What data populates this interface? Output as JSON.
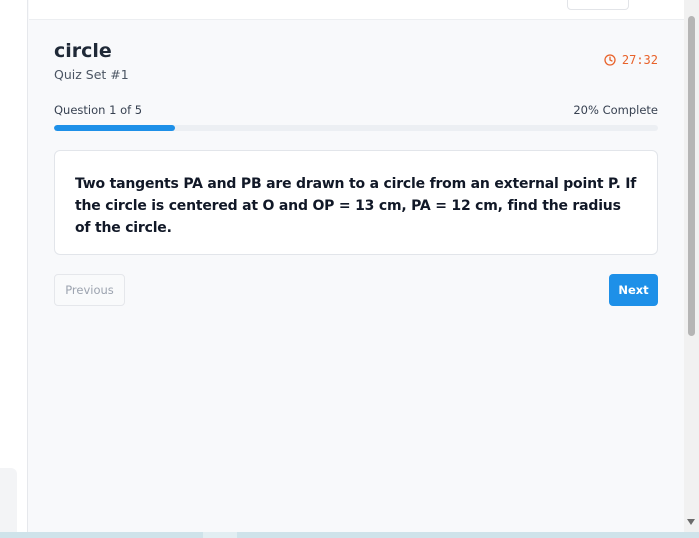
{
  "quiz": {
    "title": "circle",
    "subtitle": "Quiz Set #1",
    "timer": "27:32"
  },
  "progress": {
    "label": "Question 1 of 5",
    "percent_text": "20% Complete",
    "fraction": 0.2
  },
  "question": {
    "text": "Two tangents PA and PB are drawn to a circle from an external point P. If the circle is centered at O and OP = 13 cm, PA = 12 cm, find the radius of the circle."
  },
  "navigation": {
    "previous_label": "Previous",
    "next_label": "Next"
  },
  "colors": {
    "accent": "#1e90e8",
    "timer": "#e8622a"
  },
  "icons": {
    "timer": "clock-icon",
    "scroll_down": "scroll-down-arrow-icon"
  }
}
